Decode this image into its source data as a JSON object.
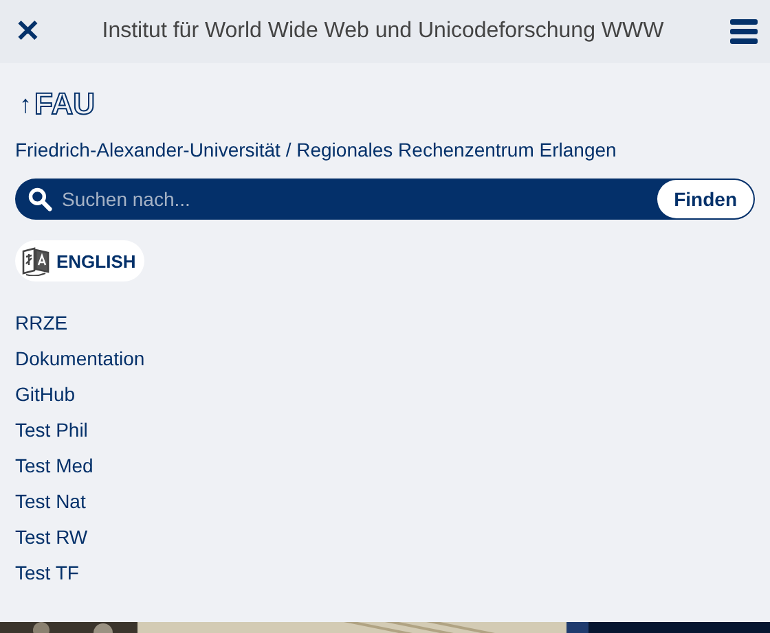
{
  "header": {
    "close": "✕",
    "title": "Institut für World Wide Web und Unicodeforschung WWW"
  },
  "logo_link": {
    "arrow": "↑",
    "label": "FAU"
  },
  "breadcrumb": "Friedrich-Alexander-Universität / Regionales Rechenzentrum Erlangen",
  "search": {
    "placeholder": "Suchen nach...",
    "button": "Finden"
  },
  "language_button": "ENGLISH",
  "links": [
    "RRZE",
    "Dokumentation",
    "GitHub",
    "Test Phil",
    "Test Med",
    "Test Nat",
    "Test RW",
    "Test TF"
  ]
}
